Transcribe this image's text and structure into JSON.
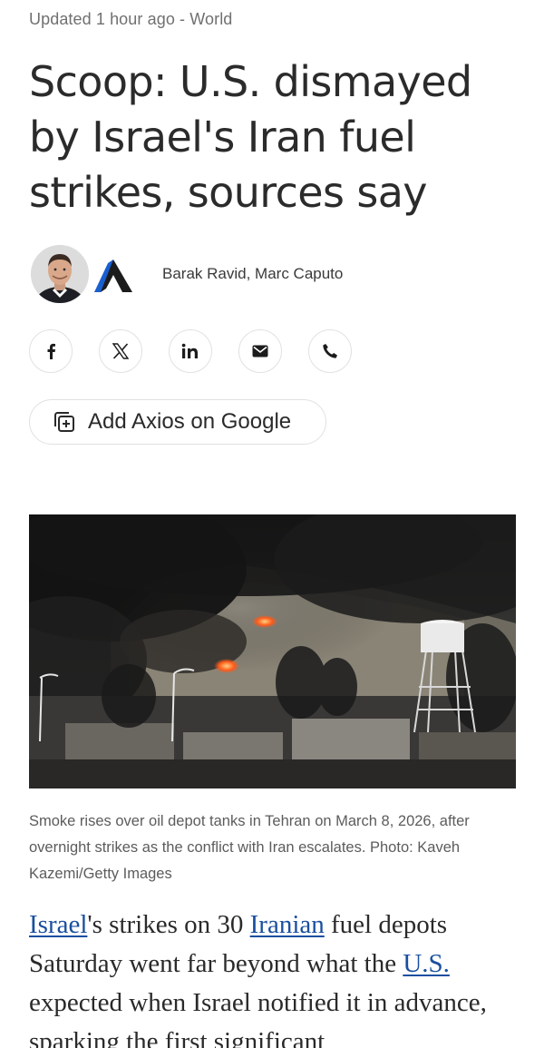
{
  "article": {
    "meta": "Updated 1 hour ago - World",
    "headline": "Scoop: U.S. dismayed by Israel's Iran fuel strikes, sources say",
    "authors": "Barak Ravid, Marc Caputo",
    "brand": "Axios"
  },
  "share": {
    "buttons": [
      {
        "name": "facebook",
        "icon": "facebook-icon",
        "glyph": "f"
      },
      {
        "name": "x",
        "icon": "x-icon",
        "glyph": "𝕏"
      },
      {
        "name": "linkedin",
        "icon": "linkedin-icon",
        "glyph": "in"
      },
      {
        "name": "email",
        "icon": "mail-icon"
      },
      {
        "name": "phone",
        "icon": "phone-icon"
      }
    ],
    "google_label": "Add Axios on Google"
  },
  "image": {
    "caption": "Smoke rises over oil depot tanks in Tehran on March 8, 2026, after overnight strikes as the conflict with Iran escalates. Photo: Kaveh Kazemi/Getty Images"
  },
  "body": {
    "link_israel": "Israel",
    "text_1": "'s strikes on 30 ",
    "link_iranian": "Iranian",
    "text_2": " fuel depots Saturday went far beyond what the ",
    "link_us": "U.S.",
    "text_3": " expected when Israel notified it in advance, sparking the first significant"
  },
  "colors": {
    "link": "#1a4fa0",
    "brand_blue": "#1a5fd0",
    "meta_text": "#707070"
  }
}
